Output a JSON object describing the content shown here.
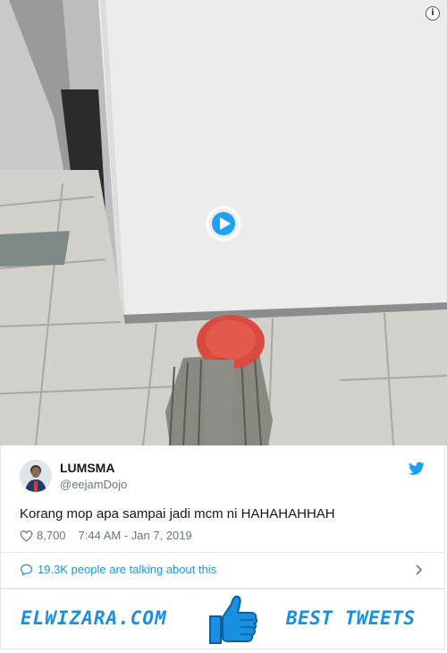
{
  "video": {
    "info_icon": "info-icon",
    "play_icon": "play-icon"
  },
  "tweet": {
    "author_name": "LUMSMA",
    "author_handle": "@eejamDojo",
    "text": "Korang mop apa sampai jadi mcm ni HAHAHAHHAH",
    "likes": "8,700",
    "timestamp": "7:44 AM - Jan 7, 2019",
    "talking": "19.3K people are talking about this",
    "accent_color": "#1b95e0"
  },
  "banner": {
    "left_text": "ELWIZARA.COM",
    "right_text": "BEST TWEETS",
    "color": "#1a8fe0"
  }
}
